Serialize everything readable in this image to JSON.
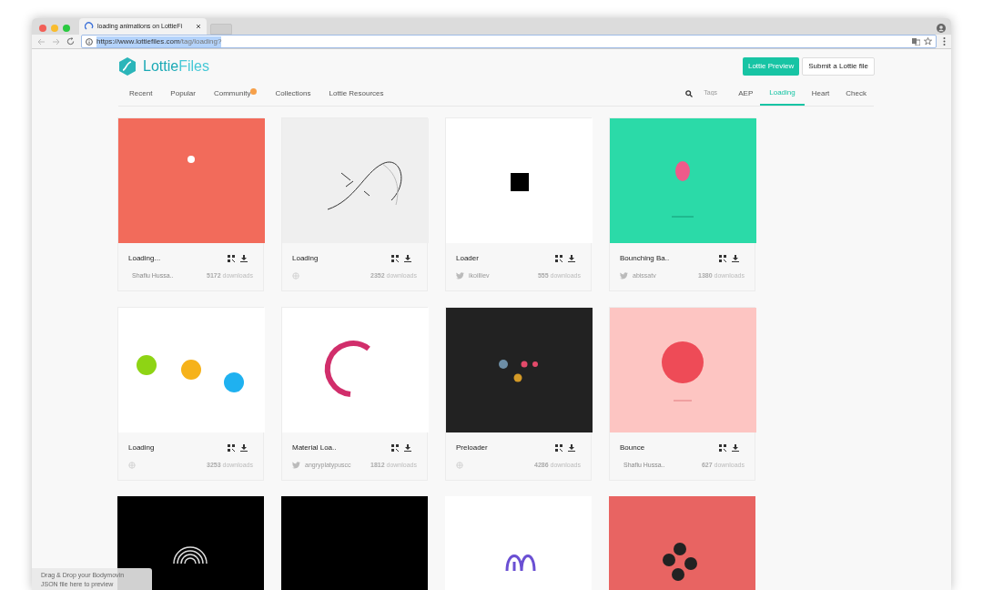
{
  "browser": {
    "tab_title": "loading animations on LottieFi",
    "url_host": "https://www.lottiefiles.com",
    "url_path": "/tag/loading?"
  },
  "brand": {
    "name_a": "Lottie",
    "name_b": "Files"
  },
  "header_buttons": [
    {
      "label": "Lottie Preview",
      "kind": "primary"
    },
    {
      "label": "Submit a Lottie file",
      "kind": "outline"
    }
  ],
  "nav": [
    {
      "label": "Recent",
      "badge": false
    },
    {
      "label": "Popular",
      "badge": false
    },
    {
      "label": "Community",
      "badge": true
    },
    {
      "label": "Collections",
      "badge": false
    },
    {
      "label": "Lottie Resources",
      "badge": false
    }
  ],
  "tags_placeholder": "Tags",
  "tags": [
    {
      "label": "AEP",
      "selected": false
    },
    {
      "label": "Loading",
      "selected": true
    },
    {
      "label": "Heart",
      "selected": false
    },
    {
      "label": "Check",
      "selected": false
    }
  ],
  "cards": [
    {
      "title": "Loading...",
      "author": {
        "kind": "plain",
        "name": "Shafiu Hussa.."
      },
      "downloads": "5172",
      "downloads_label": "downloads",
      "thumbnail": {
        "kind": "dot",
        "color": "#f26b5b"
      }
    },
    {
      "title": "Loading",
      "author": {
        "kind": "web"
      },
      "downloads": "2352",
      "downloads_label": "downloads",
      "thumbnail": {
        "kind": "sketch",
        "color": "#efefef"
      }
    },
    {
      "title": "Loader",
      "author": {
        "kind": "twitter",
        "name": "ikoilliev"
      },
      "downloads": "555",
      "downloads_label": "downloads",
      "thumbnail": {
        "kind": "square",
        "color": "#ffffff"
      }
    },
    {
      "title": "Bounching Ba..",
      "author": {
        "kind": "twitter",
        "name": "abissatv"
      },
      "downloads": "1380",
      "downloads_label": "downloads",
      "thumbnail": {
        "kind": "ball",
        "color": "#2bdaa8"
      }
    },
    {
      "title": "Loading",
      "author": {
        "kind": "web"
      },
      "downloads": "3253",
      "downloads_label": "downloads",
      "thumbnail": {
        "kind": "dots3",
        "color": "#ffffff"
      }
    },
    {
      "title": "Material Loa..",
      "author": {
        "kind": "twitter",
        "name": "angryplatypuscc"
      },
      "downloads": "1812",
      "downloads_label": "downloads",
      "thumbnail": {
        "kind": "arc",
        "color": "#ffffff"
      }
    },
    {
      "title": "Preloader",
      "author": {
        "kind": "web"
      },
      "downloads": "4286",
      "downloads_label": "downloads",
      "thumbnail": {
        "kind": "dots4",
        "color": "#222222"
      }
    },
    {
      "title": "Bounce",
      "author": {
        "kind": "plain",
        "name": "Shafiu Hussa.."
      },
      "downloads": "627",
      "downloads_label": "downloads",
      "thumbnail": {
        "kind": "bigball",
        "color": "#fdc5c2"
      }
    },
    {
      "thumbnail": {
        "kind": "rainbow",
        "color": "#000000"
      }
    },
    {
      "thumbnail": {
        "kind": "blank",
        "color": "#000000"
      }
    },
    {
      "thumbnail": {
        "kind": "squiggle",
        "color": "#ffffff"
      }
    },
    {
      "thumbnail": {
        "kind": "cluster",
        "color": "#e86462"
      }
    }
  ],
  "drop_hint": {
    "line1": "Drag & Drop your Bodymovin",
    "line2": "JSON file here to preview"
  }
}
